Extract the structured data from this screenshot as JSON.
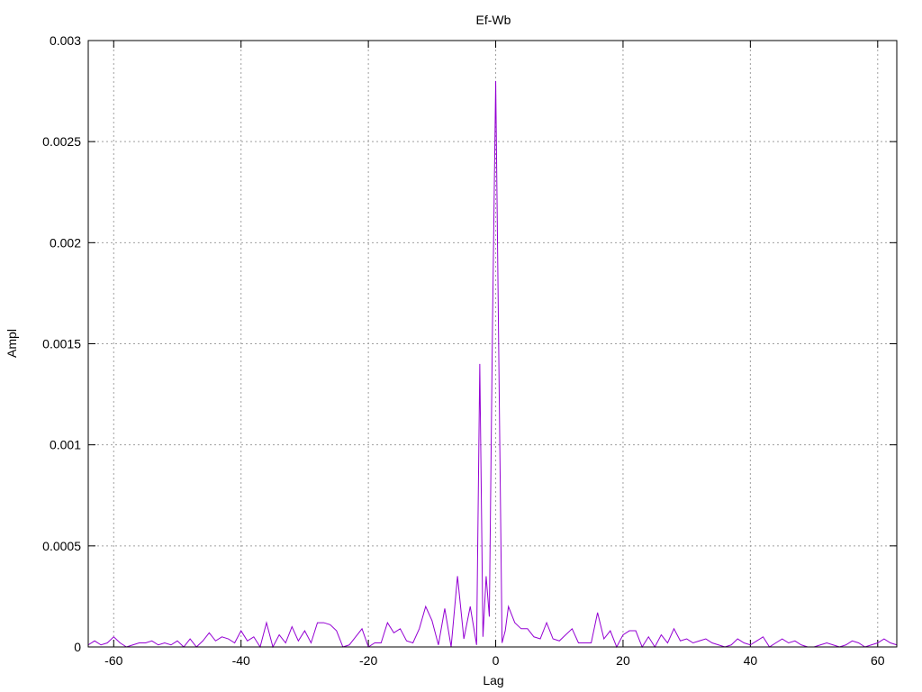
{
  "chart_data": {
    "type": "line",
    "title": "Ef-Wb",
    "xlabel": "Lag",
    "ylabel": "Ampl",
    "xlim": [
      -64,
      63
    ],
    "ylim": [
      0,
      0.003
    ],
    "grid": true,
    "line_color": "#9400d3",
    "x_ticks": [
      {
        "value": -60,
        "label": "-60"
      },
      {
        "value": -40,
        "label": "-40"
      },
      {
        "value": -20,
        "label": "-20"
      },
      {
        "value": 0,
        "label": "0"
      },
      {
        "value": 20,
        "label": "20"
      },
      {
        "value": 40,
        "label": "40"
      },
      {
        "value": 60,
        "label": "60"
      }
    ],
    "y_ticks": [
      {
        "value": 0,
        "label": "0"
      },
      {
        "value": 0.0005,
        "label": "0.0005"
      },
      {
        "value": 0.001,
        "label": "0.001"
      },
      {
        "value": 0.0015,
        "label": "0.0015"
      },
      {
        "value": 0.002,
        "label": "0.002"
      },
      {
        "value": 0.0025,
        "label": "0.0025"
      },
      {
        "value": 0.003,
        "label": "0.003"
      }
    ],
    "series": [
      {
        "x": [
          -64,
          -63,
          -62,
          -61,
          -60,
          -59,
          -58,
          -57,
          -56,
          -55,
          -54,
          -53,
          -52,
          -51,
          -50,
          -49,
          -48,
          -47,
          -46,
          -45,
          -44,
          -43,
          -42,
          -41,
          -40,
          -39,
          -38,
          -37,
          -36,
          -35,
          -34,
          -33,
          -32,
          -31,
          -30,
          -29,
          -28,
          -27,
          -26,
          -25,
          -24,
          -23,
          -22,
          -21,
          -20,
          -19,
          -18,
          -17,
          -16,
          -15,
          -14,
          -13,
          -12,
          -11,
          -10,
          -9,
          -8,
          -7,
          -6,
          -5,
          -4,
          -3,
          -2.5,
          -2,
          -1.5,
          -1,
          -0.5,
          0,
          0.5,
          1,
          1.5,
          2,
          3,
          4,
          5,
          6,
          7,
          8,
          9,
          10,
          11,
          12,
          13,
          14,
          15,
          16,
          17,
          18,
          19,
          20,
          21,
          22,
          23,
          24,
          25,
          26,
          27,
          28,
          29,
          30,
          31,
          32,
          33,
          34,
          35,
          36,
          37,
          38,
          39,
          40,
          41,
          42,
          43,
          44,
          45,
          46,
          47,
          48,
          49,
          50,
          51,
          52,
          53,
          54,
          55,
          56,
          57,
          58,
          59,
          60,
          61,
          62,
          63
        ],
        "y": [
          1e-05,
          3e-05,
          1e-05,
          2e-05,
          5e-05,
          2e-05,
          0,
          1e-05,
          2e-05,
          2e-05,
          3e-05,
          1e-05,
          2e-05,
          1e-05,
          3e-05,
          0,
          4e-05,
          0,
          3e-05,
          7e-05,
          3e-05,
          5e-05,
          4e-05,
          2e-05,
          8e-05,
          3e-05,
          5e-05,
          0,
          0.00012,
          0,
          6e-05,
          2e-05,
          0.0001,
          3e-05,
          8e-05,
          2e-05,
          0.00012,
          0.00012,
          0.00011,
          8e-05,
          0,
          1e-05,
          5e-05,
          9e-05,
          0,
          2e-05,
          2e-05,
          0.00012,
          7e-05,
          9e-05,
          3e-05,
          2e-05,
          9e-05,
          0.0002,
          0.00013,
          1e-05,
          0.00019,
          0,
          0.00035,
          4e-05,
          0.0002,
          1e-05,
          0.0014,
          5e-05,
          0.00035,
          0.00015,
          0.0016,
          0.0028,
          0.0014,
          2e-05,
          8e-05,
          0.0002,
          0.00012,
          9e-05,
          9e-05,
          5e-05,
          4e-05,
          0.00012,
          4e-05,
          3e-05,
          6e-05,
          9e-05,
          2e-05,
          2e-05,
          2e-05,
          0.00017,
          4e-05,
          8e-05,
          0,
          6e-05,
          8e-05,
          8e-05,
          0,
          5e-05,
          0,
          6e-05,
          2e-05,
          9e-05,
          3e-05,
          4e-05,
          2e-05,
          3e-05,
          4e-05,
          2e-05,
          1e-05,
          0,
          1e-05,
          4e-05,
          2e-05,
          1e-05,
          3e-05,
          5e-05,
          0,
          2e-05,
          4e-05,
          2e-05,
          3e-05,
          1e-05,
          0,
          0,
          1e-05,
          2e-05,
          1e-05,
          0,
          1e-05,
          3e-05,
          2e-05,
          0,
          1e-05,
          2e-05,
          4e-05,
          2e-05,
          1e-05
        ]
      }
    ]
  }
}
